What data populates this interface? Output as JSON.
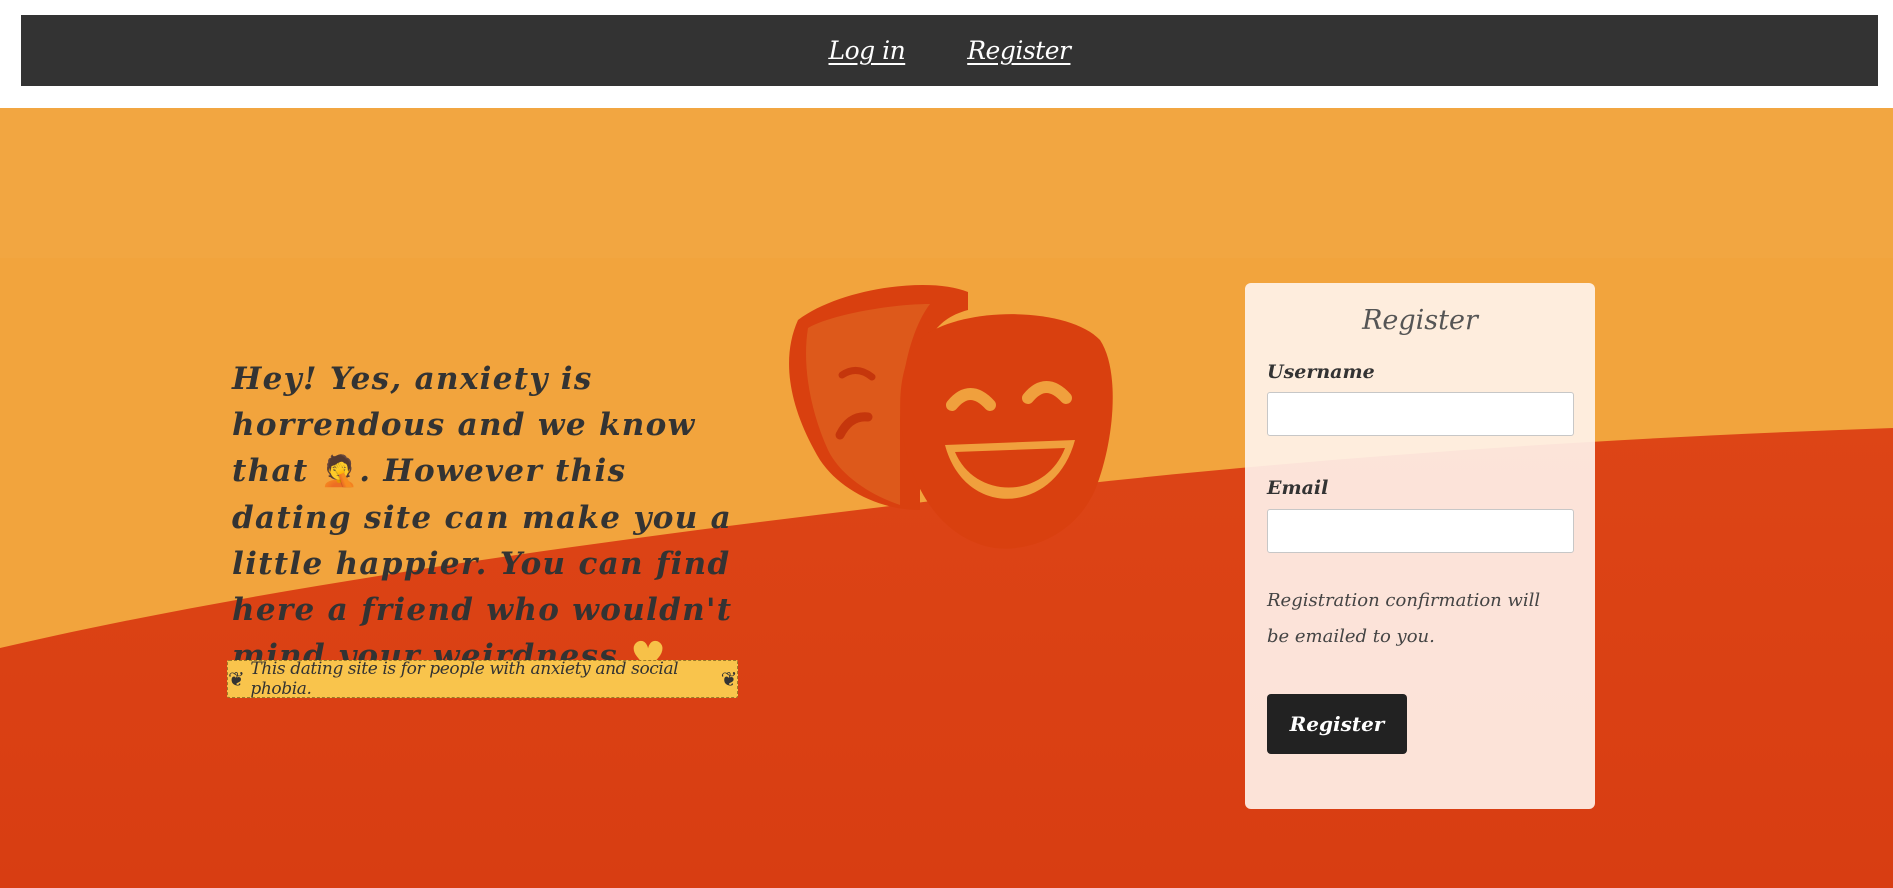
{
  "nav": {
    "login_label": "Log in",
    "register_label": "Register"
  },
  "hero": {
    "tagline_part1": "Hey! Yes, anxiety is horrendous and we know that ",
    "tagline_emoji1": "🤦",
    "tagline_part2": ". However this dating site can make you a little happier. You can find here a friend who wouldn't mind your weirdness ",
    "tagline_emoji2": "♥",
    "tagline_part3": ".",
    "notice_bullet": "❦",
    "notice_text": "This dating site is for people with anxiety and social phobia.",
    "icon": "theater-masks-icon"
  },
  "register_form": {
    "title": "Register",
    "username_label": "Username",
    "username_value": "",
    "email_label": "Email",
    "email_value": "",
    "confirmation_text": "Registration confirmation will be emailed to you.",
    "submit_label": "Register"
  },
  "colors": {
    "navbar": "#333333",
    "sky_orange": "#f1a640",
    "hill_red": "#da4014",
    "mask": "#d9400f",
    "notice_bg": "#f9c44c",
    "button": "#222222"
  }
}
